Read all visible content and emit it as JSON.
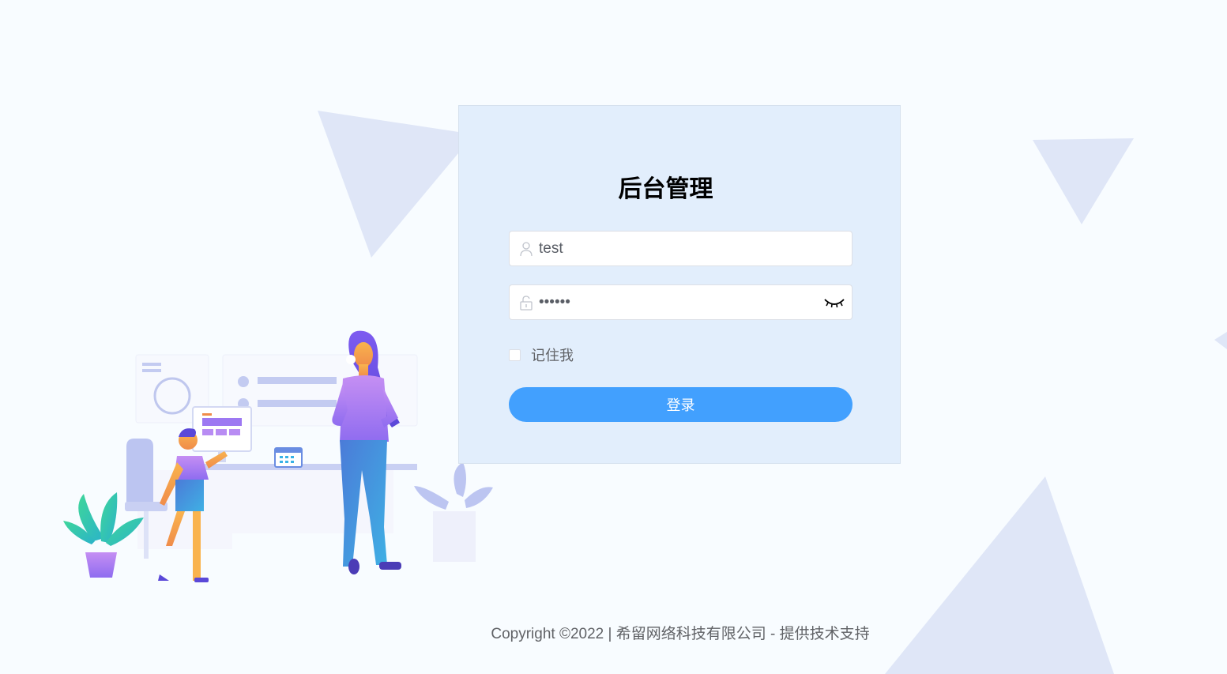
{
  "login": {
    "title": "后台管理",
    "username_value": "test",
    "password_value": "123456",
    "remember_label": "记住我",
    "submit_label": "登录"
  },
  "icons": {
    "username": "user-icon",
    "password": "unlock-icon",
    "toggle_password": "eye-closed-icon"
  },
  "colors": {
    "page_background": "#f8fcff",
    "card_background": "#e2eefc",
    "primary_button": "#42a0fe",
    "triangle": "#dfe6f7",
    "text_muted": "#606266"
  },
  "footer": {
    "copyright": "Copyright ©2022 | 希留网络科技有限公司 - 提供技术支持"
  }
}
